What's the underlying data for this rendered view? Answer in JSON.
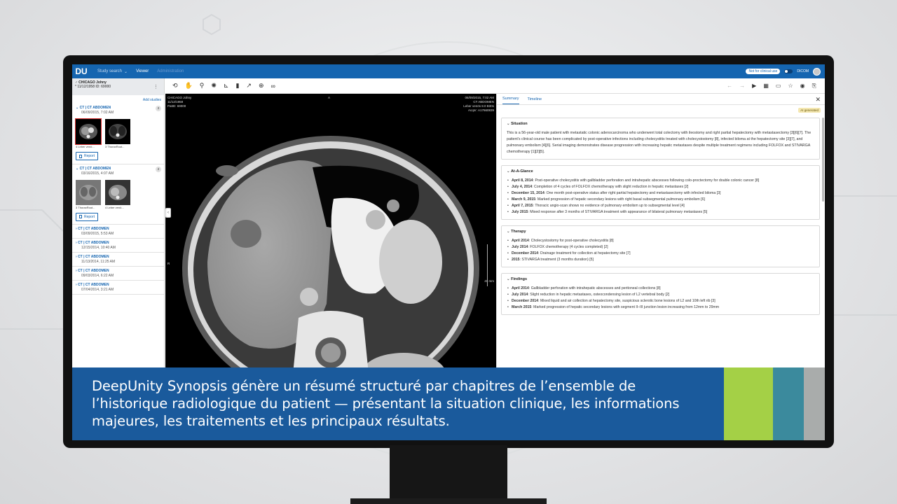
{
  "app": {
    "logo": "DU",
    "nav": [
      "Study search",
      "Viewer",
      "Administration"
    ],
    "badge": "Not for clinical use",
    "dicom": "DICOM"
  },
  "patient": {
    "name": "CHICAGO Johny",
    "dob_id": "* 11/12/1958   ID: 69000",
    "add_studies": "Add studies"
  },
  "studies": [
    {
      "title": "CT | CT ABDOMEN",
      "date": "06/09/2015, 7:02 AM",
      "count": "2",
      "expanded": true,
      "thumbs": [
        "4 Leber venö...",
        "3 ThoraxRout..."
      ],
      "report": "Report"
    },
    {
      "title": "CT | CT ABDOMEN",
      "date": "03/16/2015, 4:07 AM",
      "count": "2",
      "expanded": true,
      "thumbs": [
        "3 ThoraxRout...",
        "4 Leber venö..."
      ],
      "report": "Report"
    },
    {
      "title": "CT | CT ABDOMEN",
      "date": "03/09/2015, 5:53 AM"
    },
    {
      "title": "CT | CT ABDOMEN",
      "date": "12/15/2014, 10:40 AM"
    },
    {
      "title": "CT | CT ABDOMEN",
      "date": "11/13/2014, 11:25 AM"
    },
    {
      "title": "CT | CT ABDOMEN",
      "date": "09/03/2014, 6:22 AM"
    },
    {
      "title": "CT | CT ABDOMEN",
      "date": "07/04/2014, 3:21 AM"
    }
  ],
  "viewer": {
    "top_left": [
      "CHICAGO Johny",
      "11/12/1958",
      "PatID: 69000"
    ],
    "top_center": "A",
    "top_right": [
      "06/09/2015, 7:02 AM",
      "CT ABDOMEN",
      "Leber venös 8.0 B30s",
      "Acqnr: A17660839"
    ],
    "left_marker": "R",
    "scale": "40 mm"
  },
  "panel": {
    "tabs": [
      "Summary",
      "Timeline"
    ],
    "ai_badge": "AI generated",
    "situation": {
      "title": "Situation",
      "text": "This is a 56-year-old male patient with metastatic colonic adenocarcinoma who underwent total colectomy with ileostomy and right partial hepatectomy with metastasectomy [3][6][7]. The patient's clinical course has been complicated by post-operative infections including cholecystitis treated with cholecystostomy [8], infected biloma at the hepatectomy site [3][7], and pulmonary embolism [4][6]. Serial imaging demonstrates disease progression with increasing hepatic metastases despite multiple treatment regimens including FOLFOX and STIVARGA chemotherapy [1][2][5]."
    },
    "glance": {
      "title": "At-A-Glance",
      "items": [
        {
          "date": "April 8, 2014",
          "text": ": Post-operative cholecystitis with gallbladder perforation and intrahepatic abscesses following colo-proctectomy for double colonic cancer [8]"
        },
        {
          "date": "July 4, 2014",
          "text": ": Completion of 4 cycles of FOLFOX chemotherapy with slight reduction in hepatic metastases [2]"
        },
        {
          "date": "December 15, 2014",
          "text": ": One month post-operative status after right partial hepatectomy and metastasectomy with infected biloma [3]"
        },
        {
          "date": "March 9, 2015",
          "text": ": Marked progression of hepatic secondary lesions with right basal subsegmental pulmonary embolism [6]"
        },
        {
          "date": "April 7, 2015",
          "text": ": Thoracic angio-scan shows no evidence of pulmonary embolism up to subsegmental level [4]"
        },
        {
          "date": "July 2015",
          "text": ": Mixed response after 3 months of STIVARGA treatment with appearance of bilateral pulmonary metastases [5]"
        }
      ]
    },
    "therapy": {
      "title": "Therapy",
      "items": [
        {
          "date": "April 2014",
          "text": ": Cholecystostomy for post-operative cholecystitis [8]"
        },
        {
          "date": "July 2014",
          "text": ": FOLFOX chemotherapy (4 cycles completed) [2]"
        },
        {
          "date": "December 2014",
          "text": ": Drainage treatment for collection at hepatectomy site [7]"
        },
        {
          "date": "2015",
          "text": ": STIVARGA treatment (3 months duration) [5]"
        }
      ]
    },
    "findings": {
      "title": "Findings",
      "items": [
        {
          "date": "April 2014",
          "text": ": Gallbladder perforation with intrahepatic abscesses and peritoneal collections [8]"
        },
        {
          "date": "July 2014",
          "text": ": Slight reduction in hepatic metastases, osteocondensing lesion of L2 vertebral body [2]"
        },
        {
          "date": "December 2014",
          "text": ": Mixed liquid and air collection at hepatectomy site, suspicious sclerotic bone lesions of L2 and 10th left rib [3]"
        },
        {
          "date": "March 2015",
          "text": ": Marked progression of hepatic secondary lesions with segment II–III junction lesion increasing from 12mm to 29mm"
        }
      ]
    }
  },
  "caption": "DeepUnity Synopsis génère un résumé structuré par chapitres de l’ensemble de l’historique radiologique du patient — présentant la situation clinique, les informations majeures, les traitements et les principaux résultats.",
  "colors": {
    "accent": "#1565b0",
    "banner": "#1a5a9c",
    "green": "#a4d046",
    "teal": "#3b8a9d",
    "grey": "#a9acab"
  }
}
